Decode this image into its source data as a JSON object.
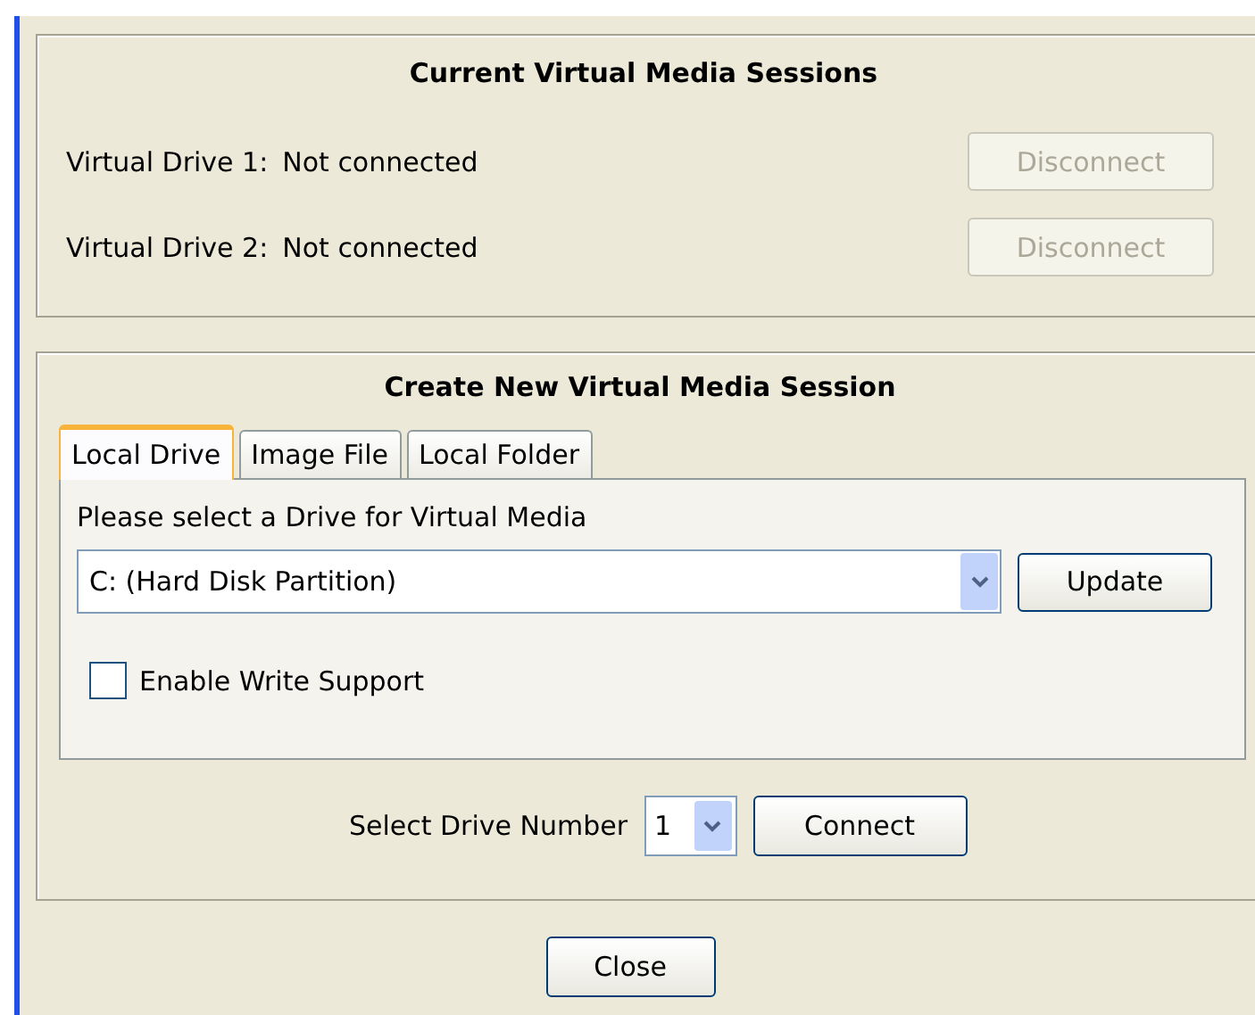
{
  "current_sessions": {
    "title": "Current Virtual Media Sessions",
    "drives": [
      {
        "label": "Virtual Drive 1:",
        "status": "Not connected",
        "button": {
          "label": "Disconnect",
          "disabled": true
        }
      },
      {
        "label": "Virtual Drive 2:",
        "status": "Not connected",
        "button": {
          "label": "Disconnect",
          "disabled": true
        }
      }
    ]
  },
  "create_session": {
    "title": "Create New Virtual Media Session",
    "tabs": [
      {
        "label": "Local Drive",
        "selected": true
      },
      {
        "label": "Image File",
        "selected": false
      },
      {
        "label": "Local Folder",
        "selected": false
      }
    ],
    "prompt": "Please select a Drive for Virtual Media",
    "drive_dropdown": {
      "value": "C: (Hard Disk Partition)"
    },
    "update_button": "Update",
    "write_support": {
      "label": "Enable Write Support",
      "checked": false
    },
    "drive_number": {
      "label": "Select Drive Number",
      "value": "1"
    },
    "connect_button": "Connect"
  },
  "close_button": "Close"
}
